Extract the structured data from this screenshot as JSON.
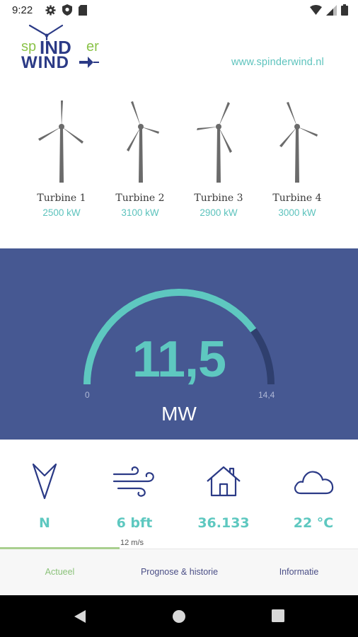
{
  "status_bar": {
    "time": "9:22",
    "left_icons": [
      "gear-icon",
      "shield-icon",
      "sd-card-icon"
    ],
    "right_icons": [
      "wifi-icon",
      "signal-icon",
      "battery-icon"
    ]
  },
  "header": {
    "logo_text_top": "spINDer",
    "logo_text_bottom": "WIND",
    "website": "www.spinderwind.nl"
  },
  "turbines": [
    {
      "name": "Turbine 1",
      "power": "2500 kW"
    },
    {
      "name": "Turbine 2",
      "power": "3100 kW"
    },
    {
      "name": "Turbine 3",
      "power": "2900 kW"
    },
    {
      "name": "Turbine 4",
      "power": "3000 kW"
    }
  ],
  "gauge": {
    "value": "11,5",
    "unit": "MW",
    "min_label": "0",
    "max_label": "14,4",
    "fraction": 0.8
  },
  "stats": [
    {
      "icon": "wind-direction-arrow-icon",
      "value": "N"
    },
    {
      "icon": "wind-icon",
      "value": "6 bft",
      "sub": "12 m/s"
    },
    {
      "icon": "house-icon",
      "value": "36.133"
    },
    {
      "icon": "cloud-icon",
      "value": "22  °C"
    }
  ],
  "bottom_nav": {
    "tabs": [
      {
        "label": "Actueel",
        "active": true
      },
      {
        "label": "Prognose & historie",
        "active": false
      },
      {
        "label": "Informatie",
        "active": false
      }
    ]
  },
  "colors": {
    "accent_teal": "#5ec8c0",
    "panel_blue": "#465892",
    "active_tab_green": "#8bc27a",
    "nav_text": "#4a4e86"
  }
}
